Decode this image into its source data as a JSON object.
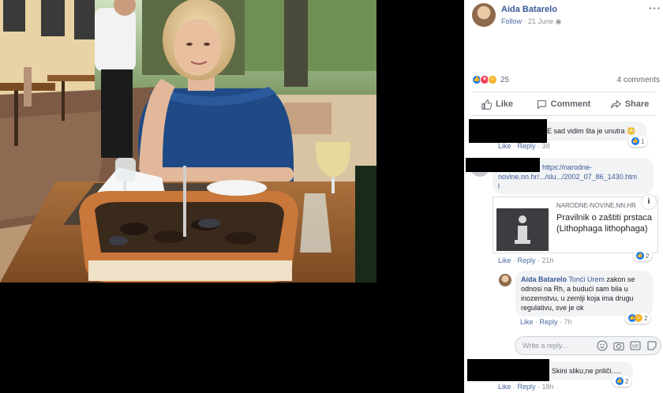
{
  "post": {
    "author": "Aida Batarelo",
    "follow": "Follow",
    "date": "21 June",
    "more": "···",
    "reaction_count": "25",
    "comments_count": "4 comments"
  },
  "actions": {
    "like": "Like",
    "comment": "Comment",
    "share": "Share"
  },
  "comments": [
    {
      "text": "E sad vidim šta je unutra 😳",
      "like": "Like",
      "reply": "Reply",
      "time": "3d",
      "reactions": "1"
    },
    {
      "link_line1": "https://narodne-",
      "link_line2": "novine.nn.hr/.../slu.../2002_07_86_1430.htm",
      "link_line3": "l",
      "preview_domain": "NARODNE-NOVINE.NN.HR",
      "preview_title": "Pravilnik o zaštiti prstaca (Lithophaga lithophaga)",
      "preview_info": "i",
      "like": "Like",
      "reply": "Reply",
      "time": "21h",
      "reactions": "2"
    },
    {
      "author": "Aida Batarelo",
      "mention": "Tonći Urem",
      "text": " zakon se odnosi na Rh, a budući sam bila u inozemstvu, u zemlji koja ima drugu regulativu, sve je ok",
      "like": "Like",
      "reply": "Reply",
      "time": "7h",
      "reactions": "2"
    },
    {
      "text": "Skini sliku,ne priliči.....",
      "like": "Like",
      "reply": "Reply",
      "time": "18h",
      "reactions": "2"
    }
  ],
  "reply_box": {
    "placeholder": "Write a reply..."
  },
  "colors": {
    "link_blue": "#385898",
    "like_blue": "#1877f2",
    "love_red": "#f33e58",
    "haha_yellow": "#f7b125",
    "meta_grey": "#90949c"
  }
}
